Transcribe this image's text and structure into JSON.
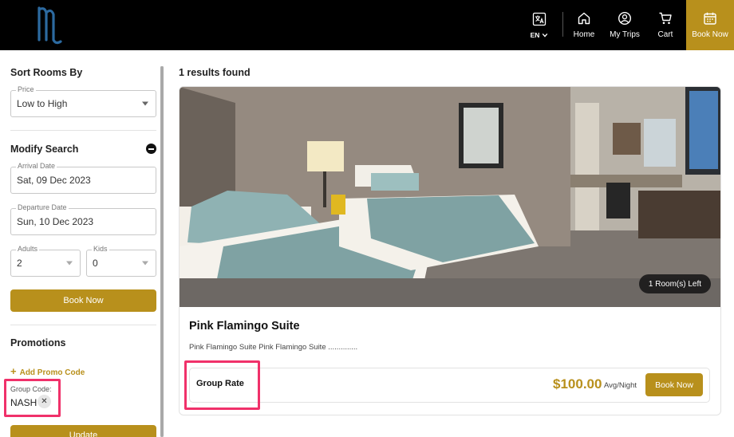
{
  "header": {
    "logo_icon": "brand-logo",
    "nav": {
      "language": "EN",
      "home": "Home",
      "trips": "My Trips",
      "cart": "Cart",
      "book": "Book Now"
    }
  },
  "sidebar": {
    "sort_title": "Sort Rooms By",
    "sort_label": "Price",
    "sort_value": "Low to High",
    "modify_title": "Modify Search",
    "arrival_label": "Arrival Date",
    "arrival_value": "Sat, 09 Dec 2023",
    "departure_label": "Departure Date",
    "departure_value": "Sun, 10 Dec 2023",
    "adults_label": "Adults",
    "adults_value": "2",
    "kids_label": "Kids",
    "kids_value": "0",
    "book_button": "Book Now",
    "promotions_title": "Promotions",
    "add_promo": "Add Promo Code",
    "group_code_label": "Group Code:",
    "group_code_value": "NASH",
    "update_button": "Update"
  },
  "main": {
    "results_count": "1 results found",
    "rooms": [
      {
        "availability": "1 Room(s) Left",
        "name": "Pink Flamingo Suite",
        "description": "Pink Flamingo Suite Pink Flamingo Suite ..............",
        "rate_name": "Group Rate",
        "price": "$100.00",
        "price_unit": "Avg/Night",
        "book_button": "Book Now"
      }
    ]
  },
  "colors": {
    "accent": "#b8901c",
    "header_bg": "#000000",
    "highlight": "#f0316a"
  }
}
